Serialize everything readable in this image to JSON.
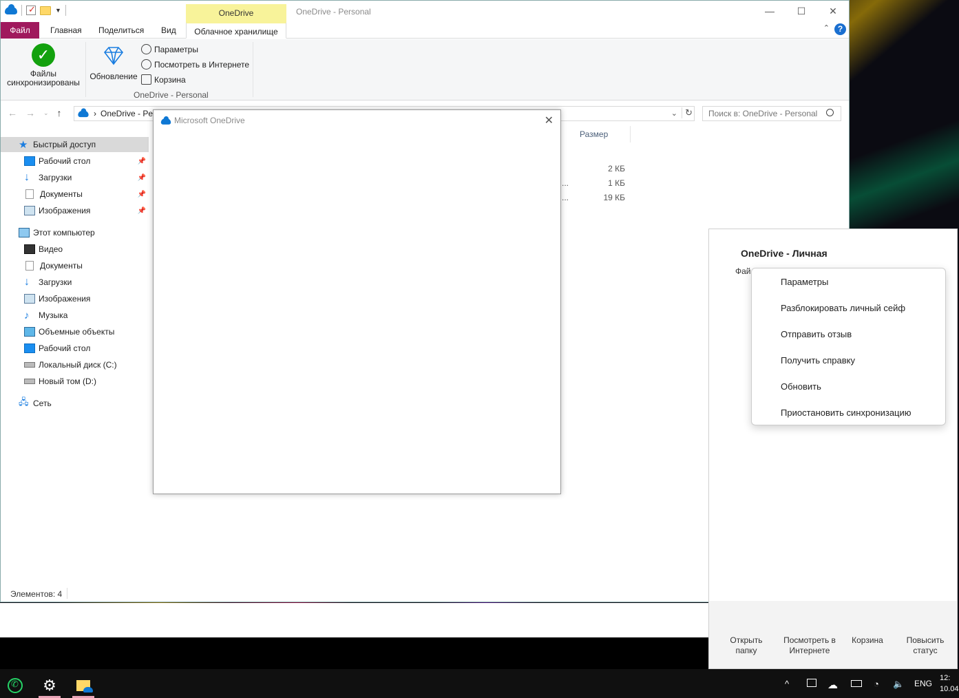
{
  "explorer": {
    "window_title": "OneDrive - Personal",
    "context_tab_header": "OneDrive",
    "tabs": [
      {
        "label": "Файл"
      },
      {
        "label": "Главная"
      },
      {
        "label": "Поделиться"
      },
      {
        "label": "Вид"
      },
      {
        "label": "Облачное хранилище"
      }
    ],
    "ribbon": {
      "synced_label": "Файлы синхронизированы",
      "update_label": "Обновление",
      "params_label": "Параметры",
      "view_online_label": "Посмотреть в Интернете",
      "recycle_label": "Корзина",
      "group_label": "OneDrive - Personal"
    },
    "address": "OneDrive - Per",
    "search_placeholder": "Поиск в: OneDrive - Personal",
    "sidebar": {
      "quick_access": "Быстрый доступ",
      "quick_items": [
        "Рабочий стол",
        "Загрузки",
        "Документы",
        "Изображения"
      ],
      "this_pc": "Этот компьютер",
      "pc_items": [
        "Видео",
        "Документы",
        "Загрузки",
        "Изображения",
        "Музыка",
        "Объемные объекты",
        "Рабочий стол",
        "Локальный диск (C:)",
        "Новый том (D:)"
      ],
      "network": "Сеть"
    },
    "column_size": "Размер",
    "rows": [
      {
        "size": "2 КБ",
        "trunc": ""
      },
      {
        "size": "1 КБ",
        "trunc": "..."
      },
      {
        "size": "19 КБ",
        "trunc": "..."
      }
    ],
    "status": "Элементов: 4"
  },
  "dialog": {
    "title": "Microsoft OneDrive"
  },
  "flyout": {
    "title": "OneDrive - Личная",
    "sub": "Фай",
    "menu": [
      "Параметры",
      "Разблокировать личный сейф",
      "Отправить отзыв",
      "Получить справку",
      "Обновить",
      "Приостановить синхронизацию"
    ],
    "footer": [
      {
        "line1": "Открыть",
        "line2": "папку"
      },
      {
        "line1": "Посмотреть в",
        "line2": "Интернете"
      },
      {
        "line1": "Корзина",
        "line2": ""
      },
      {
        "line1": "Повысить",
        "line2": "статус"
      }
    ]
  },
  "taskbar": {
    "lang": "ENG",
    "time": "12:",
    "date": "10.04"
  }
}
